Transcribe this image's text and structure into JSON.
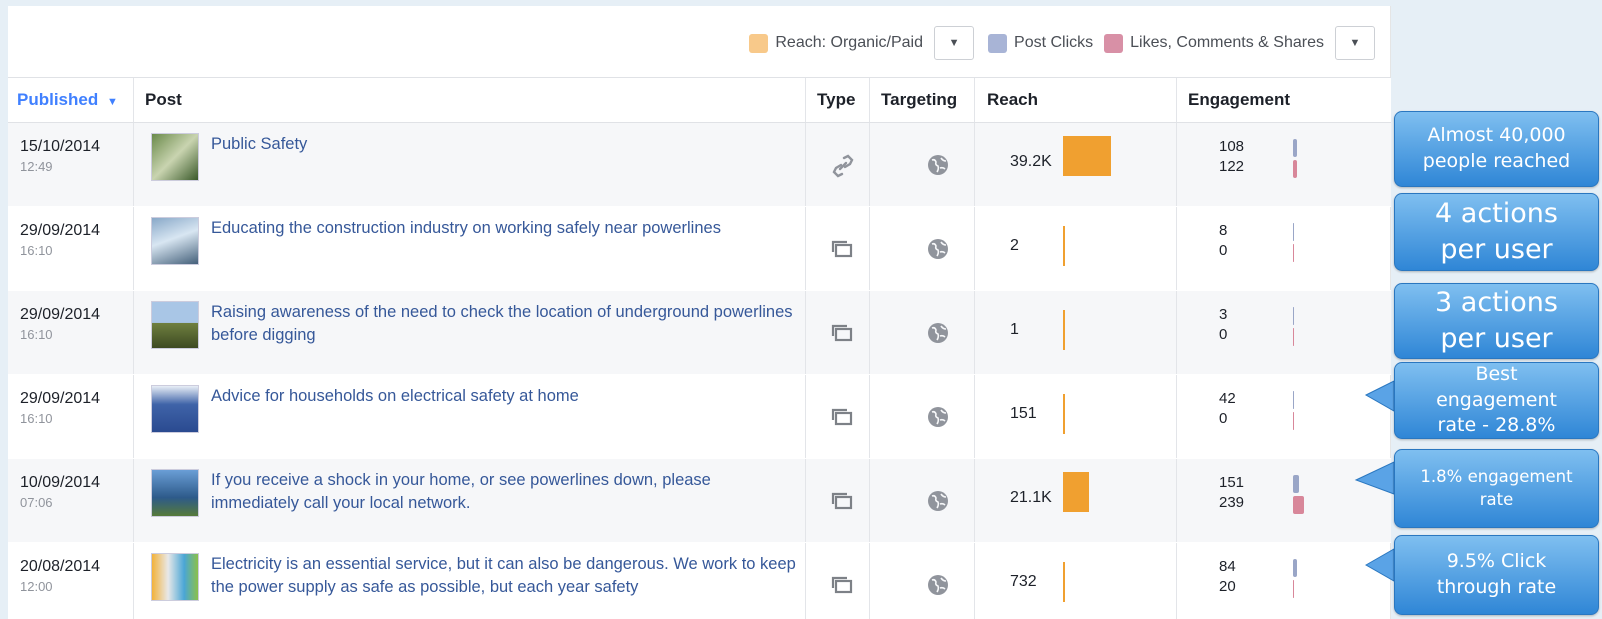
{
  "legend": {
    "reach_label": "Reach: Organic/Paid",
    "clicks_label": "Post Clicks",
    "likes_label": "Likes, Comments & Shares",
    "colors": {
      "reach": "#f8c98a",
      "clicks": "#a8b4d6",
      "likes": "#d890a6"
    }
  },
  "headers": {
    "published": "Published",
    "published_sort_icon": "caret-down-icon",
    "post": "Post",
    "type": "Type",
    "targeting": "Targeting",
    "reach": "Reach",
    "engagement": "Engagement"
  },
  "rows": [
    {
      "date": "15/10/2014",
      "time": "12:49",
      "post": "Public Safety",
      "type_icon": "link-icon",
      "targeting_icon": "globe-icon",
      "reach": "39.2K",
      "reach_level": 1.0,
      "clicks": "108",
      "likes": "122",
      "clicks_level": 0.45,
      "likes_level": 0.5
    },
    {
      "date": "29/09/2014",
      "time": "16:10",
      "post": "Educating the construction industry on working safely near powerlines",
      "type_icon": "album-icon",
      "targeting_icon": "globe-icon",
      "reach": "2",
      "reach_level": 0.0,
      "clicks": "8",
      "likes": "0",
      "clicks_level": 0.0,
      "likes_level": 0.0
    },
    {
      "date": "29/09/2014",
      "time": "16:10",
      "post": "Raising awareness of the need to check the location of underground powerlines before digging",
      "type_icon": "album-icon",
      "targeting_icon": "globe-icon",
      "reach": "1",
      "reach_level": 0.0,
      "clicks": "3",
      "likes": "0",
      "clicks_level": 0.0,
      "likes_level": 0.0
    },
    {
      "date": "29/09/2014",
      "time": "16:10",
      "post": "Advice for households on electrical safety at home",
      "type_icon": "album-icon",
      "targeting_icon": "globe-icon",
      "reach": "151",
      "reach_level": 0.0,
      "clicks": "42",
      "likes": "0",
      "clicks_level": 0.0,
      "likes_level": 0.0
    },
    {
      "date": "10/09/2014",
      "time": "07:06",
      "post": "If you receive a shock in your home, or see powerlines down, please immediately call your local network.",
      "type_icon": "album-icon",
      "targeting_icon": "globe-icon",
      "reach": "21.1K",
      "reach_level": 0.54,
      "clicks": "151",
      "likes": "239",
      "clicks_level": 0.63,
      "likes_level": 1.0
    },
    {
      "date": "20/08/2014",
      "time": "12:00",
      "post": "Electricity is an essential service, but it can also be dangerous. We work to keep the power supply as safe as possible, but each year safety",
      "type_icon": "album-icon",
      "targeting_icon": "globe-icon",
      "reach": "732",
      "reach_level": 0.02,
      "clicks": "84",
      "likes": "20",
      "clicks_level": 0.35,
      "likes_level": 0.08
    }
  ],
  "callouts": [
    {
      "line1": "Almost 40,000",
      "line2": "people reached",
      "line3": ""
    },
    {
      "line1": "4 actions",
      "line2": "per user",
      "line3": ""
    },
    {
      "line1": "3 actions",
      "line2": "per user",
      "line3": ""
    },
    {
      "line1": "Best",
      "line2": "engagement",
      "line3": "rate - 28.8%"
    },
    {
      "line1": "1.8% engagement",
      "line2": "rate",
      "line3": ""
    },
    {
      "line1": "9.5% Click",
      "line2": "through rate",
      "line3": ""
    }
  ]
}
